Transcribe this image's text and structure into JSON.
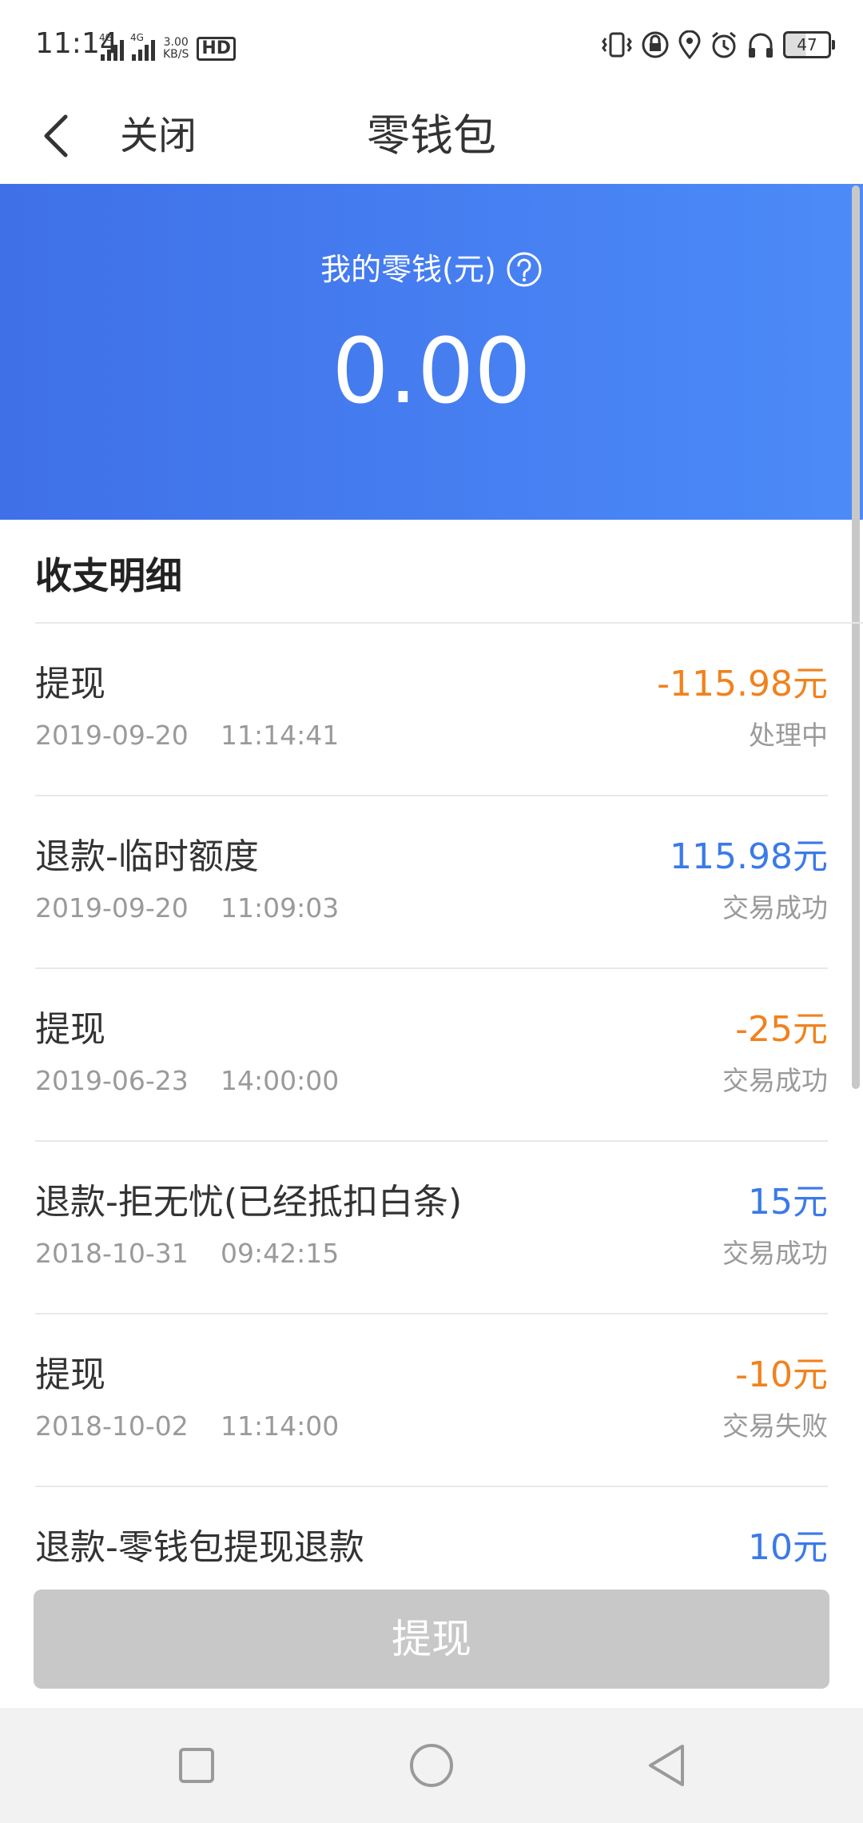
{
  "status_bar": {
    "time": "11:14",
    "net_label_1": "4G",
    "net_label_2": "4G",
    "speed_value": "3.00",
    "speed_unit": "KB/S",
    "hd_label": "HD",
    "battery": "47"
  },
  "nav": {
    "close_label": "关闭",
    "title": "零钱包"
  },
  "balance": {
    "label": "我的零钱(元)",
    "amount": "0.00"
  },
  "section_title": "收支明细",
  "transactions": [
    {
      "title": "提现",
      "date": "2019-09-20",
      "time": "11:14:41",
      "amount": "-115.98元",
      "status": "处理中"
    },
    {
      "title": "退款-临时额度",
      "date": "2019-09-20",
      "time": "11:09:03",
      "amount": "115.98元",
      "status": "交易成功"
    },
    {
      "title": "提现",
      "date": "2019-06-23",
      "time": "14:00:00",
      "amount": "-25元",
      "status": "交易成功"
    },
    {
      "title": "退款-拒无忧(已经抵扣白条)",
      "date": "2018-10-31",
      "time": "09:42:15",
      "amount": "15元",
      "status": "交易成功"
    },
    {
      "title": "提现",
      "date": "2018-10-02",
      "time": "11:14:00",
      "amount": "-10元",
      "status": "交易失败"
    },
    {
      "title": "退款-零钱包提现退款",
      "date": "",
      "time": "",
      "amount": "10元",
      "status": ""
    }
  ],
  "withdraw_button": "提现",
  "colors": {
    "header_gradient_start": "#3f70e8",
    "header_gradient_end": "#4c8bf8",
    "negative_amount": "#f0821e",
    "positive_amount": "#3b7ae8",
    "disabled_button": "#c8c8c8"
  }
}
